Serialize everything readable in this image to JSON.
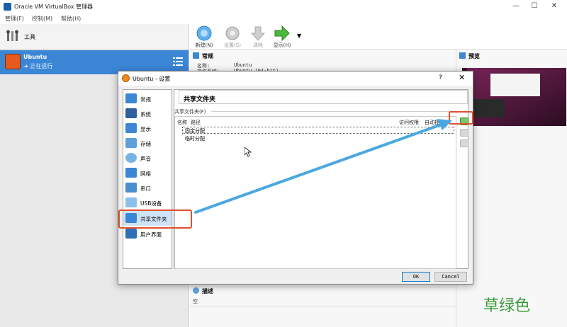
{
  "window": {
    "title": "Oracle VM VirtualBox 管理器",
    "controls": [
      "—",
      "☐",
      "✕"
    ]
  },
  "menubar": {
    "items": [
      "管理(F)",
      "控制(M)",
      "帮助(H)"
    ]
  },
  "left_pane": {
    "tools_label": "工具",
    "vm": {
      "name": "Ubuntu",
      "state": "正在运行"
    }
  },
  "toolbar": {
    "new_label": "新建(N)",
    "settings_label": "设置(S)",
    "discard_label": "清除",
    "show_label": "显示(H)"
  },
  "details": {
    "general_title": "常规",
    "general_name_label": "名称:",
    "general_name_value": "Ubuntu",
    "general_os_label": "操作系统:",
    "general_os_value": "Ubuntu (64-bit)",
    "description_title": "描述",
    "description_value": "空"
  },
  "preview": {
    "title": "预览"
  },
  "dialog": {
    "title": "Ubuntu - 设置",
    "help": "?",
    "close": "✕",
    "nav": [
      {
        "label": "常规",
        "color": "#3c86d6"
      },
      {
        "label": "系统",
        "color": "#2f5f9e"
      },
      {
        "label": "显示",
        "color": "#3c86d6"
      },
      {
        "label": "存储",
        "color": "#5fa0dc"
      },
      {
        "label": "声音",
        "color": "#7ab4e6"
      },
      {
        "label": "网络",
        "color": "#3c86d6"
      },
      {
        "label": "串口",
        "color": "#4a8fd0"
      },
      {
        "label": "USB设备",
        "color": "#8cc0ec"
      },
      {
        "label": "共享文件夹",
        "color": "#3c86d6"
      },
      {
        "label": "用户界面",
        "color": "#2f6fb8"
      }
    ],
    "page_title": "共享文件夹",
    "group_label": "共享文件夹(F)",
    "columns": {
      "name": "名称",
      "path": "路径",
      "access": "访问权限",
      "automount": "自动挂载"
    },
    "rows": [
      "固定分配",
      "临时分配"
    ],
    "ok_label": "OK",
    "cancel_label": "Cancel"
  },
  "annotation": {
    "watermark": "草绿色",
    "highlight_color": "#e0502d",
    "arrow_color": "#4aa8e0"
  }
}
